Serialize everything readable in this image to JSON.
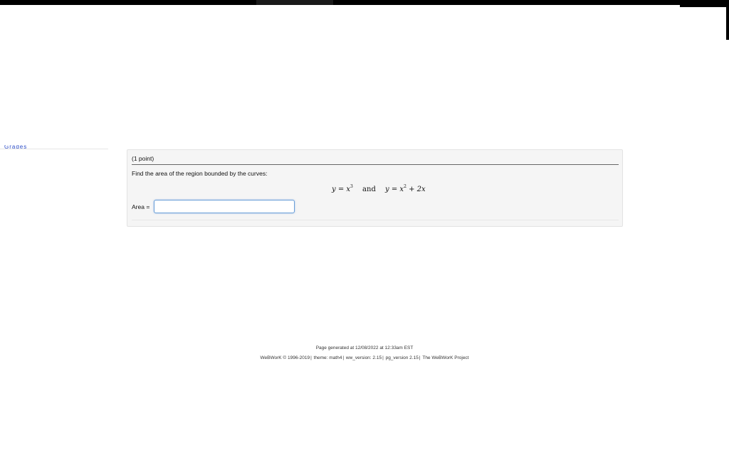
{
  "sidebar": {
    "link_text": "Grades"
  },
  "problem": {
    "points": "(1 point)",
    "prompt": "Find the area of the region bounded by the curves:",
    "equation": {
      "lhs1": "y = x",
      "exp1": "3",
      "conj": "and",
      "lhs2": "y = x",
      "exp2": "2",
      "rest2": " + 2x"
    },
    "answer": {
      "label": "Area =",
      "value": ""
    }
  },
  "footer": {
    "generated": "Page generated at 12/08/2022 at 12:33am EST",
    "copyright": "WeBWorK © 1996-2019",
    "theme": "theme: math4",
    "ww_version": "ww_version: 2.15",
    "pg_version": "pg_version 2.15",
    "project": "The WeBWorK Project"
  },
  "colors": {
    "link": "#2b4cc8",
    "input_focus": "#6a9fd8",
    "panel_bg": "#f5f5f5"
  }
}
